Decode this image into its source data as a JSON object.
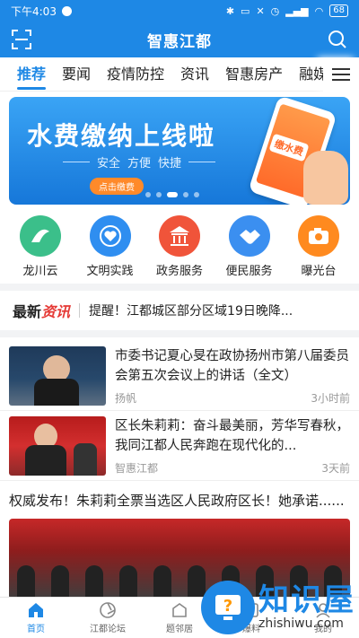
{
  "status_bar": {
    "time": "下午4:03",
    "battery": "68"
  },
  "header": {
    "title": "智惠江都",
    "scan_icon": "scan-icon",
    "search_icon": "search-icon"
  },
  "tabs": [
    "推荐",
    "要闻",
    "疫情防控",
    "资讯",
    "智惠房产",
    "融媒"
  ],
  "active_tab": "推荐",
  "banner": {
    "headline": "水费缴纳上线啦",
    "subtitle_words": [
      "安全",
      "方便",
      "快捷"
    ],
    "cta": "点击缴费",
    "phone_label": "缴水费",
    "page_count": 5,
    "active_index": 2
  },
  "quick_links": [
    {
      "label": "龙川云",
      "icon": "longchuan-icon",
      "color": "#3bbf8a"
    },
    {
      "label": "文明实践",
      "icon": "heart-icon",
      "color": "#2f8ef0"
    },
    {
      "label": "政务服务",
      "icon": "building-icon",
      "color": "#f0543a"
    },
    {
      "label": "便民服务",
      "icon": "handshake-icon",
      "color": "#3b8ff0"
    },
    {
      "label": "曝光台",
      "icon": "camera-icon",
      "color": "#ff8a1f"
    }
  ],
  "ticker": {
    "brand_black": "最新",
    "brand_red": "资讯",
    "text": "提醒！江都城区部分区域19日晚降..."
  },
  "news": [
    {
      "title": "市委书记夏心旻在政协扬州市第八届委员会第五次会议上的讲话（全文）",
      "source": "扬帆",
      "time": "3小时前"
    },
    {
      "title": "区长朱莉莉：奋斗最美丽，芳华写春秋，我同江都人民奔跑在现代化的...",
      "source": "智惠江都",
      "time": "3天前"
    }
  ],
  "feature_news": {
    "title": "权威发布！朱莉莉全票当选区人民政府区长！她承诺......"
  },
  "tabbar": [
    {
      "label": "首页",
      "icon": "home-icon",
      "active": true
    },
    {
      "label": "江都论坛",
      "icon": "forum-icon",
      "active": false
    },
    {
      "label": "题邻居",
      "icon": "neighbor-icon",
      "active": false
    },
    {
      "label": "爆料",
      "icon": "report-icon",
      "active": false
    },
    {
      "label": "我的",
      "icon": "profile-icon",
      "active": false
    }
  ],
  "watermark": {
    "cn": "知识屋",
    "en": "zhishiwu.com"
  }
}
